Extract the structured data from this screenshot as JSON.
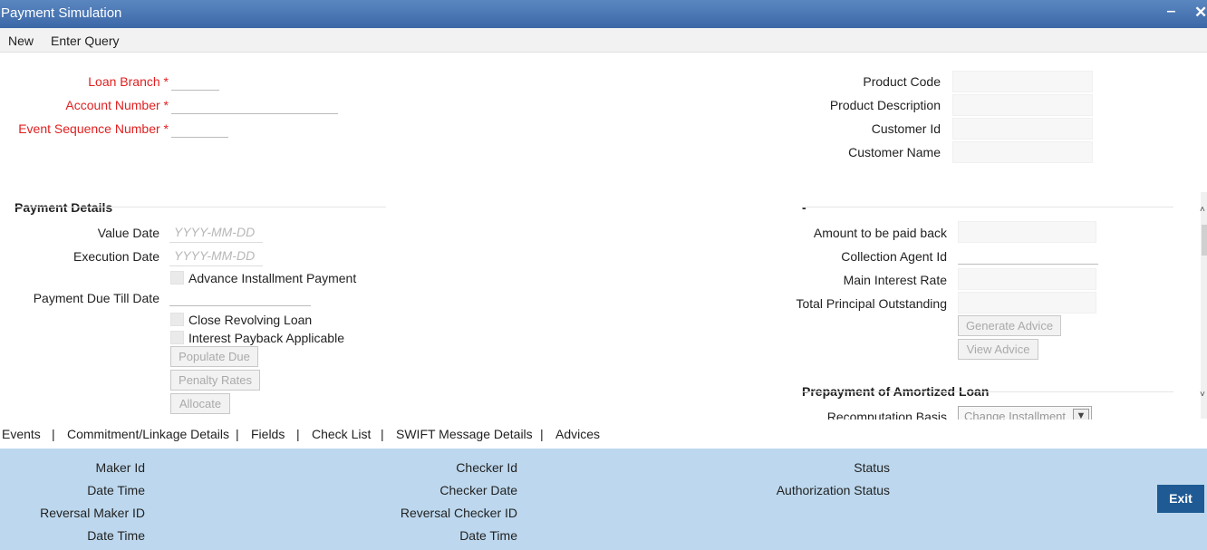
{
  "window": {
    "title": "Payment Simulation",
    "minimize": "‒",
    "close": "✕"
  },
  "menu": {
    "new": "New",
    "enter_query": "Enter Query"
  },
  "header": {
    "loan_branch": "Loan Branch",
    "account_number": "Account Number",
    "event_sequence_number": "Event Sequence Number",
    "required_marker": "*",
    "product_code": "Product Code",
    "product_description": "Product Description",
    "customer_id": "Customer Id",
    "customer_name": "Customer Name"
  },
  "payment_details": {
    "title": "Payment Details",
    "value_date": "Value Date",
    "execution_date": "Execution Date",
    "date_placeholder": "YYYY-MM-DD",
    "advance_installment_payment": "Advance Installment Payment",
    "payment_due_till_date": "Payment Due Till Date",
    "close_revolving_loan": "Close Revolving Loan",
    "interest_payback_applicable": "Interest Payback Applicable",
    "populate_due": "Populate Due",
    "penalty_rates": "Penalty Rates",
    "allocate": "Allocate"
  },
  "right_panel": {
    "title": "-",
    "amount_to_be_paid_back": "Amount to be paid back",
    "collection_agent_id": "Collection Agent Id",
    "main_interest_rate": "Main Interest Rate",
    "total_principal_outstanding": "Total Principal Outstanding",
    "generate_advice": "Generate Advice",
    "view_advice": "View Advice"
  },
  "prepayment": {
    "title": "Prepayment of Amortized Loan",
    "recomputation_basis": "Recomputation Basis",
    "recomputation_value": "Change Installment"
  },
  "tabs": {
    "events": "Events",
    "commitment": "Commitment/Linkage Details",
    "fields": "Fields",
    "check_list": "Check List",
    "swift": "SWIFT Message Details",
    "advices": "Advices",
    "separator": "|"
  },
  "footer": {
    "maker_id": "Maker Id",
    "date_time": "Date Time",
    "reversal_maker_id": "Reversal Maker ID",
    "checker_id": "Checker Id",
    "checker_date": "Checker Date",
    "reversal_checker_id": "Reversal Checker ID",
    "status": "Status",
    "authorization_status": "Authorization Status",
    "exit": "Exit"
  },
  "scroll": {
    "up": "˄",
    "down": "˅"
  },
  "colors": {
    "title_bar": "#3c68a8",
    "footer": "#bdd8ee",
    "required": "#e02020",
    "exit_button": "#1f5a94"
  }
}
